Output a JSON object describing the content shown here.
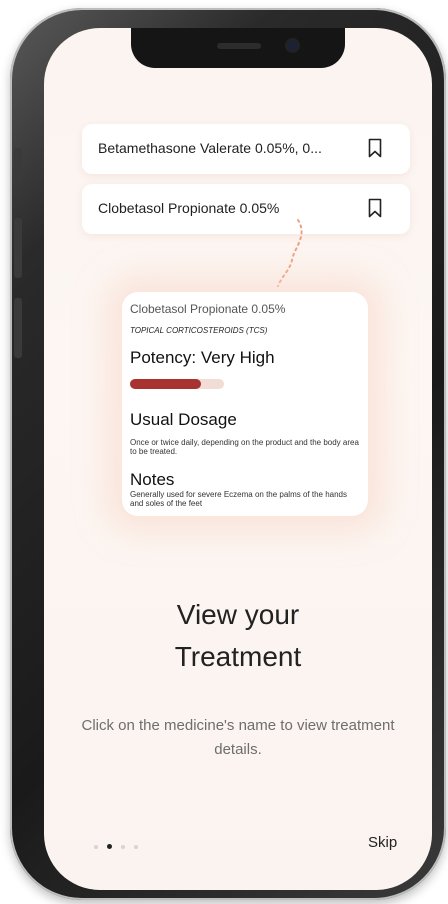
{
  "medicines": [
    {
      "name": "Betamethasone Valerate 0.05%, 0..."
    },
    {
      "name": "Clobetasol Propionate 0.05%"
    }
  ],
  "detail": {
    "name": "Clobetasol Propionate 0.05%",
    "category": "TOPICAL CORTICOSTEROIDS (TCS)",
    "potency": "Potency: Very High",
    "potency_level_percent": 75,
    "dosage_heading": "Usual Dosage",
    "dosage_text": "Once or twice daily, depending on the product and the body area to be treated.",
    "notes_heading": "Notes",
    "notes_text": "Generally used for severe Eczema on the palms of the hands and soles of the feet"
  },
  "onboarding": {
    "title_line1": "View your",
    "title_line2": "Treatment",
    "description": "Click on the medicine's name to view treatment details.",
    "page_count": 4,
    "active_page": 1,
    "skip_label": "Skip"
  },
  "colors": {
    "accent": "#a8322f",
    "dotted_line": "#f0a080",
    "background": "#fbf4f0"
  }
}
